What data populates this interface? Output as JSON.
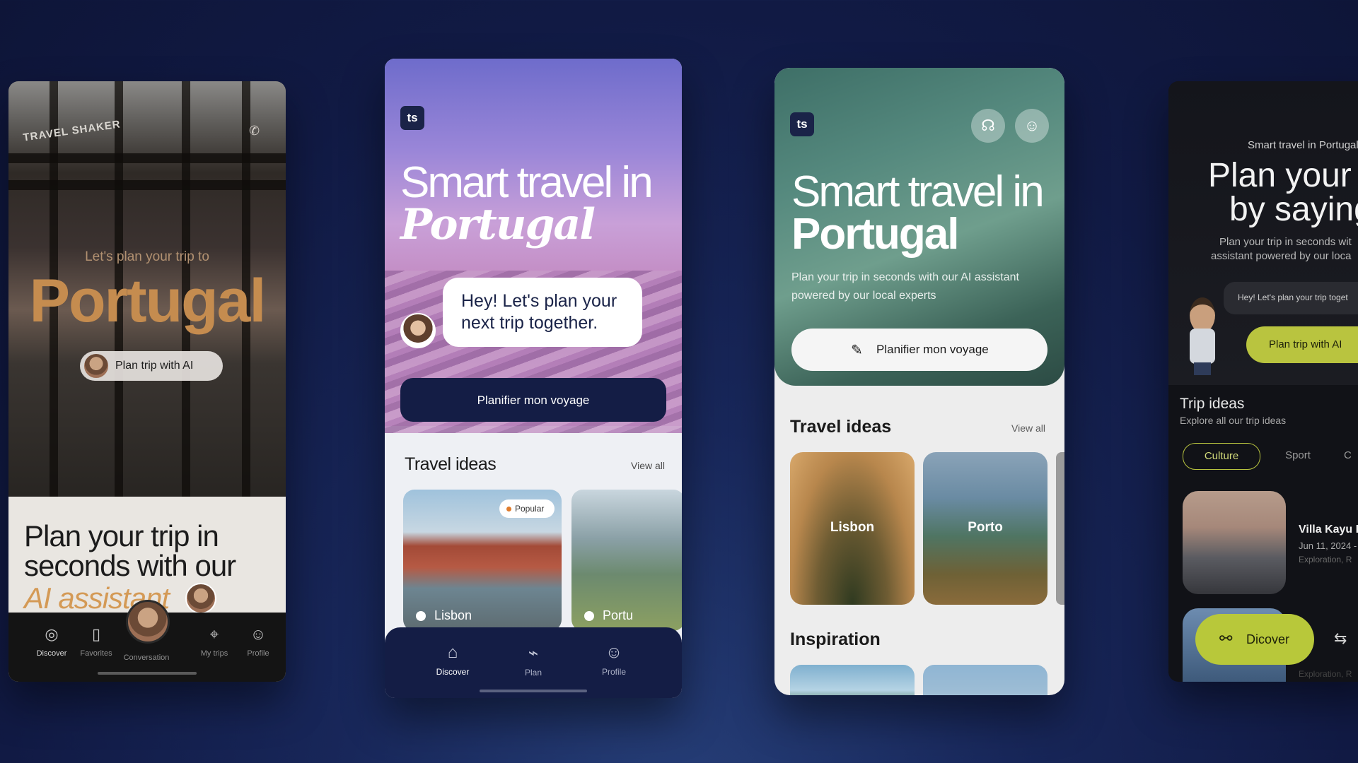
{
  "phone1": {
    "logo": "TRAVEL SHAKER",
    "subtitle": "Let's plan your trip to",
    "headline": "Portugal",
    "pill_label": "Plan trip with AI",
    "bottom_line1": "Plan your trip in seconds with our",
    "bottom_line2": "AI assistant",
    "nav": [
      {
        "label": "Discover",
        "icon": "compass-icon"
      },
      {
        "label": "Favorites",
        "icon": "bookmark-icon"
      },
      {
        "label": "Conversation",
        "icon": "avatar"
      },
      {
        "label": "My trips",
        "icon": "route-icon"
      },
      {
        "label": "Profile",
        "icon": "user-icon"
      }
    ]
  },
  "phone2": {
    "logo": "ts",
    "title_line1": "Smart travel in",
    "title_line2": "Portugal",
    "bubble": "Hey! Let's plan your next trip together.",
    "cta": "Planifier mon voyage",
    "section_title": "Travel ideas",
    "view_all": "View all",
    "cards": [
      {
        "label": "Lisbon",
        "tag": "Popular"
      },
      {
        "label": "Portu"
      }
    ],
    "nav": [
      {
        "label": "Discover",
        "icon": "home-icon"
      },
      {
        "label": "Plan",
        "icon": "route-icon"
      },
      {
        "label": "Profile",
        "icon": "user-icon"
      }
    ]
  },
  "phone3": {
    "logo": "ts",
    "title_line1": "Smart travel in",
    "title_line2": "Portugal",
    "description": "Plan your trip in seconds with our AI assistant powered by our local experts",
    "cta": "Planifier mon voyage",
    "section_title": "Travel ideas",
    "view_all": "View all",
    "cards": [
      {
        "label": "Lisbon"
      },
      {
        "label": "Porto"
      }
    ],
    "section2_title": "Inspiration"
  },
  "phone4": {
    "small_title": "Smart travel in Portugal",
    "big_title_line1": "Plan your t",
    "big_title_line2": "by saying",
    "description_line1": "Plan your trip in seconds wit",
    "description_line2": "assistant powered by our loca",
    "bubble": "Hey! Let's plan your trip toget",
    "ai_button": "Plan trip with AI",
    "trip_title": "Trip ideas",
    "trip_subtitle": "Explore all our trip ideas",
    "chips": [
      "Culture",
      "Sport",
      "C"
    ],
    "trip_name": "Villa Kayu L",
    "trip_date": "Jun 11, 2024 - J",
    "trip_tag": "Exploration, R",
    "trip_tag2": "Exploration, R",
    "discover_button": "Dicover"
  }
}
